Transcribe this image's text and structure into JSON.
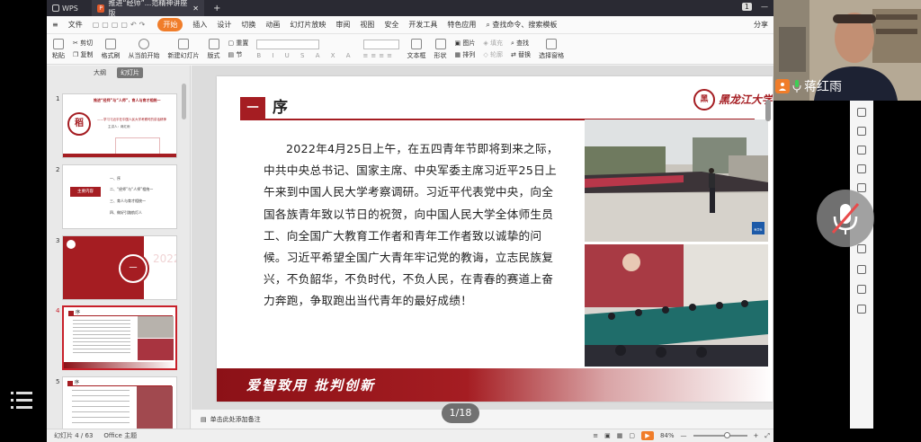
{
  "titlebar": {
    "app_name": "WPS",
    "doc_tab": "推进“经师”...范精神讲座版",
    "badge": "1"
  },
  "menubar": {
    "file": "文件",
    "tabs": [
      "开始",
      "插入",
      "设计",
      "切换",
      "动画",
      "幻灯片放映",
      "审阅",
      "视图",
      "安全",
      "开发工具",
      "特色应用"
    ],
    "search": "查找命令、搜索模板",
    "share": "分享"
  },
  "ribbon": {
    "paste": "粘贴",
    "cut": "剪切",
    "copy": "复制",
    "format_painter": "格式刷",
    "from_current": "从当前开始",
    "new_slide": "新建幻灯片",
    "layout": "版式",
    "section": "节",
    "reset": "重置",
    "textbox": "文本框",
    "shape": "形状",
    "arrange": "排列",
    "picture": "图片",
    "fill": "填充",
    "outline": "轮廓",
    "find": "查找",
    "replace": "替换",
    "select_pane": "选择窗格"
  },
  "leftpanel": {
    "tab_outline": "大纲",
    "tab_slides": "幻灯片",
    "slide_numbers": [
      "1",
      "2",
      "3",
      "4",
      "5"
    ],
    "thumb1": {
      "title": "推进“经师”与“人师”，育人与育才相统一",
      "subtitle": "——学习习近平在中国人民大学考察时的讲话精神",
      "speaker": "主讲人：蒋红雨"
    },
    "thumb2": {
      "label": "主要内容",
      "items": [
        "一、序",
        "二、“经师”与“人师”相统一",
        "三、育人与育才相统一",
        "四、做好引路航灯人"
      ]
    },
    "thumb3": {
      "number": "一",
      "label": "序"
    },
    "thumb4": {
      "title": "序"
    },
    "thumb5": {
      "title": "序"
    }
  },
  "slide": {
    "section_number": "一",
    "section_title": "序",
    "logo_text": "黑龙江大学",
    "body": "2022年4月25日上午，在五四青年节即将到来之际，中共中央总书记、国家主席、中央军委主席习近平25日上午来到中国人民大学考察调研。习近平代表党中央，向全国各族青年致以节日的祝贺，向中国人民大学全体师生员工、向全国广大教育工作者和青年工作者致以诚挚的问候。习近平希望全国广大青年牢记党的教诲，立志民族复兴，不负韶华，不负时代，不负人民，在青春的赛道上奋力奔跑，争取跑出当代青年的最好成绩！",
    "motto": "爱智致用 批判创新",
    "photo_badge": "新华社"
  },
  "notes": {
    "placeholder": "单击此处添加备注"
  },
  "statusbar": {
    "slide_counter": "幻灯片 4 / 63",
    "theme": "Office 主题",
    "zoom": "84%"
  },
  "page_badge": "1/18",
  "video": {
    "participant_name": "蒋红雨"
  },
  "colors": {
    "accent_red": "#a51d22",
    "wps_orange": "#f07d2a"
  }
}
